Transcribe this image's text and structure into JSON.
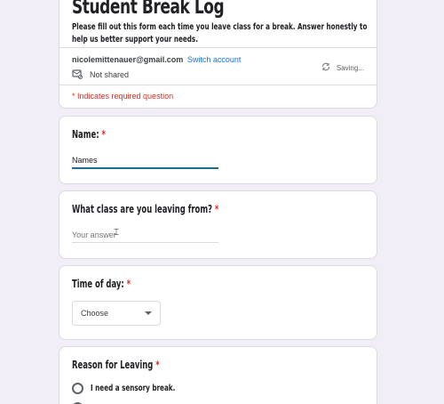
{
  "form": {
    "title": "Student Break Log",
    "description": "Please fill out this form each time you leave class for a break. Answer honestly to help us better support your needs."
  },
  "account": {
    "email": "nicolemittenauer@gmail.com",
    "switch_label": "Switch account",
    "shared_status": "Not shared",
    "saving_status": "Saving..."
  },
  "required_note": "* Indicates required question",
  "questions": {
    "name": {
      "label": "Name:",
      "asterisk": "*",
      "value": "Names"
    },
    "class": {
      "label": "What class are you leaving from?",
      "asterisk": "*",
      "placeholder": "Your answer"
    },
    "time": {
      "label": "Time of day:",
      "asterisk": "*",
      "selected": "Choose"
    },
    "reason": {
      "label": "Reason for Leaving",
      "asterisk": "*",
      "options": [
        "I need a sensory break."
      ]
    }
  }
}
